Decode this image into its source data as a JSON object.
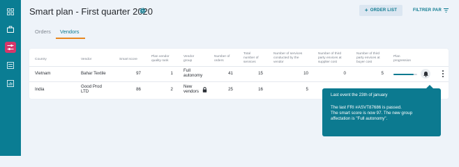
{
  "sidebar": {
    "items": [
      {
        "icon": "dashboard-icon"
      },
      {
        "icon": "briefcase-icon"
      },
      {
        "icon": "sliders-icon",
        "active": true
      },
      {
        "icon": "list-icon"
      },
      {
        "icon": "chart-icon"
      }
    ]
  },
  "header": {
    "title": "Smart plan - First quarter 2020",
    "order_list_label": "ORDER LIST",
    "filter_label": "FILTRER PAR"
  },
  "tabs": {
    "orders": "Orders",
    "vendors": "Vendors"
  },
  "table": {
    "columns": {
      "country": "Country",
      "vendor": "Vendor",
      "smart_score": "Smart score",
      "plan_rank_1": "Plan vendor",
      "plan_rank_2": "quality rank",
      "vendor_group_1": "Vendor",
      "vendor_group_2": "group",
      "orders_1": "Number of",
      "orders_2": "orders",
      "total_1": "Total",
      "total_2": "number of",
      "total_3": "services",
      "conducted_1": "Number of services",
      "conducted_2": "conducted by the",
      "conducted_3": "vendor",
      "supplier_1": "Number of third",
      "supplier_2": "party envices at",
      "supplier_3": "supplier cost",
      "buyer_1": "Number of third",
      "buyer_2": "party envices at",
      "buyer_3": "buyer cost",
      "progress_1": "Plan",
      "progress_2": "progression"
    },
    "rows": [
      {
        "country": "Vietnam",
        "vendor_1": "Bahar Textile",
        "vendor_2": "",
        "smart_score": "97",
        "plan_rank": "1",
        "group_1": "Full",
        "group_2": "autonomy",
        "orders": "41",
        "total": "15",
        "conducted": "10",
        "supplier": "0",
        "buyer": "5",
        "progress": 0.85
      },
      {
        "country": "India",
        "vendor_1": "Good Prod",
        "vendor_2": "LTD",
        "smart_score": "86",
        "plan_rank": "2",
        "group_1": "New",
        "group_2": "vendors",
        "orders": "25",
        "total": "16",
        "conducted": "5"
      }
    ]
  },
  "tooltip": {
    "heading": "Last event the 23th of january",
    "line1": "The last FRI #ASVT87686 is passed.",
    "line2": "The smart score is now 97. The new group",
    "line3": "affectation is \"Full autonomy\"."
  },
  "colors": {
    "sidebar": "#0a7d93",
    "accent": "#0c7a90",
    "active_nav": "#d6376a",
    "tab_underline": "#e8871e"
  }
}
